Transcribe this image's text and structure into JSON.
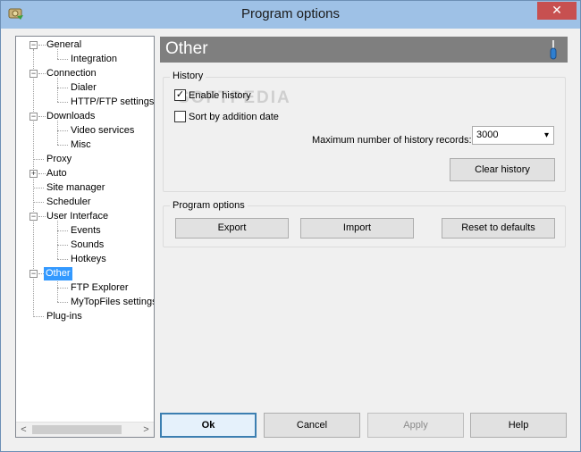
{
  "window": {
    "title": "Program options",
    "close_glyph": "✕"
  },
  "tree": {
    "items": [
      {
        "label": "General"
      },
      {
        "label": "Integration"
      },
      {
        "label": "Connection"
      },
      {
        "label": "Dialer"
      },
      {
        "label": "HTTP/FTP settings"
      },
      {
        "label": "Downloads"
      },
      {
        "label": "Video services"
      },
      {
        "label": "Misc"
      },
      {
        "label": "Proxy"
      },
      {
        "label": "Auto"
      },
      {
        "label": "Site manager"
      },
      {
        "label": "Scheduler"
      },
      {
        "label": "User Interface"
      },
      {
        "label": "Events"
      },
      {
        "label": "Sounds"
      },
      {
        "label": "Hotkeys"
      },
      {
        "label": "Other"
      },
      {
        "label": "FTP Explorer"
      },
      {
        "label": "MyTopFiles settings"
      },
      {
        "label": "Plug-ins"
      }
    ],
    "selected": "Other",
    "scroll_left": "<",
    "scroll_right": ">"
  },
  "panel": {
    "title": "Other",
    "history": {
      "group_label": "History",
      "enable_history": {
        "label": "Enable history",
        "checked": true,
        "mark": "✓"
      },
      "sort_by_date": {
        "label": "Sort by addition date",
        "checked": false
      },
      "max_records_label": "Maximum number of history records:",
      "max_records_value": "3000",
      "clear_history_label": "Clear history"
    },
    "program_options": {
      "group_label": "Program options",
      "export_label": "Export",
      "import_label": "Import",
      "reset_label": "Reset to defaults"
    },
    "watermark": "SOFTPEDIA"
  },
  "footer": {
    "ok_label": "Ok",
    "cancel_label": "Cancel",
    "apply_label": "Apply",
    "help_label": "Help"
  },
  "colors": {
    "titlebar": "#9ec1e6",
    "header_bar": "#7f7f7f",
    "selection": "#3399ff",
    "close": "#c75050"
  }
}
